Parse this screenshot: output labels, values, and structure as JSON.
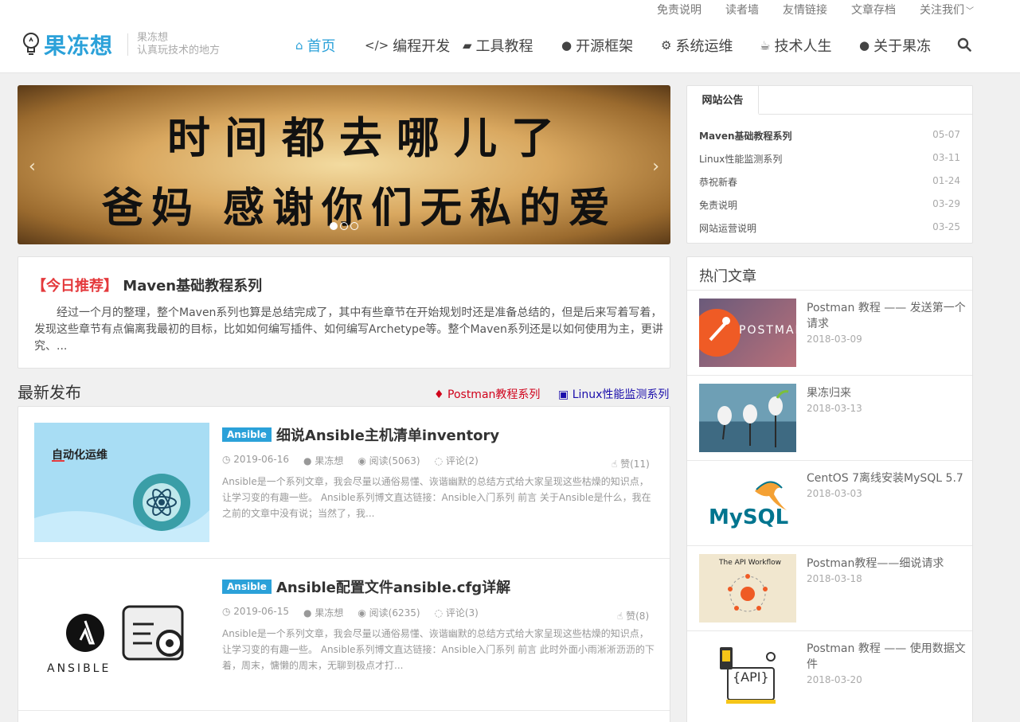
{
  "topnav": [
    "免责说明",
    "读者墙",
    "友情链接",
    "文章存档",
    "关注我们"
  ],
  "logo": {
    "name": "果冻想",
    "sub1": "果冻想",
    "sub2": "认真玩技术的地方"
  },
  "mainnav": [
    {
      "label": "首页",
      "icon": "home-icon",
      "glyph": "⌂"
    },
    {
      "label": "编程开发",
      "icon": "code-icon",
      "glyph": "</>"
    },
    {
      "label": "工具教程",
      "icon": "book-icon",
      "glyph": "▰"
    },
    {
      "label": "开源框架",
      "icon": "github-icon",
      "glyph": "●"
    },
    {
      "label": "系统运维",
      "icon": "gears-icon",
      "glyph": "⚙"
    },
    {
      "label": "技术人生",
      "icon": "coffee-icon",
      "glyph": "☕"
    },
    {
      "label": "关于果冻",
      "icon": "user-icon",
      "glyph": "●"
    }
  ],
  "slider": {
    "line1": "时间都去哪儿了",
    "line2": "爸妈 感谢你们无私的爱"
  },
  "recommend": {
    "tag": "【今日推荐】",
    "title": "Maven基础教程系列",
    "body": "经过一个月的整理，整个Maven系列也算是总结完成了，其中有些章节在开始规划时还是准备总结的，但是后来写着写着，发现这些章节有点偏离我最初的目标，比如如何编写插件、如何编写Archetype等。整个Maven系列还是以如何使用为主，更讲究、..."
  },
  "latest": {
    "heading": "最新发布",
    "links": [
      {
        "label": "Postman教程系列",
        "color": "#d0021b"
      },
      {
        "label": "Linux性能监测系列",
        "color": "#1a0dab"
      }
    ]
  },
  "articles": [
    {
      "tag": "Ansible",
      "title": "细说Ansible主机清单inventory",
      "date": "2019-06-16",
      "author": "果冻想",
      "views": "阅读(5063)",
      "comments": "评论(2)",
      "likes": "赞(11)",
      "thumb_text": "自动化运维",
      "excerpt": "Ansible是一个系列文章，我会尽量以通俗易懂、诙谐幽默的总结方式给大家呈现这些枯燥的知识点，让学习变的有趣一些。 Ansible系列博文直达链接：Ansible入门系列 前言 关于Ansible是什么，我在之前的文章中没有说；当然了，我..."
    },
    {
      "tag": "Ansible",
      "title": "Ansible配置文件ansible.cfg详解",
      "date": "2019-06-15",
      "author": "果冻想",
      "views": "阅读(6235)",
      "comments": "评论(3)",
      "likes": "赞(8)",
      "thumb_text": "ANSIBLE",
      "excerpt": "Ansible是一个系列文章，我会尽量以通俗易懂、诙谐幽默的总结方式给大家呈现这些枯燥的知识点，让学习变的有趣一些。 Ansible系列博文直达链接：Ansible入门系列 前言 此时外面小雨淅淅沥沥的下着，周末，慵懒的周末，无聊到极点才打..."
    }
  ],
  "notice": {
    "title": "网站公告",
    "items": [
      {
        "label": "Maven基础教程系列",
        "date": "05-07"
      },
      {
        "label": "Linux性能监测系列",
        "date": "03-11"
      },
      {
        "label": "恭祝新春",
        "date": "01-24"
      },
      {
        "label": "免责说明",
        "date": "03-29"
      },
      {
        "label": "网站运营说明",
        "date": "03-25"
      }
    ]
  },
  "hot": {
    "title": "热门文章",
    "items": [
      {
        "title": "Postman 教程 —— 发送第一个请求",
        "date": "2018-03-09",
        "thumb_text": "POSTMAN"
      },
      {
        "title": "果冻归来",
        "date": "2018-03-13",
        "thumb_text": ""
      },
      {
        "title": "CentOS 7离线安装MySQL 5.7",
        "date": "2018-03-03",
        "thumb_text": "MySQL"
      },
      {
        "title": "Postman教程——细说请求",
        "date": "2018-03-18",
        "thumb_text": "The API Workflow"
      },
      {
        "title": "Postman 教程 —— 使用数据文件",
        "date": "2018-03-20",
        "thumb_text": "{API}"
      }
    ]
  }
}
